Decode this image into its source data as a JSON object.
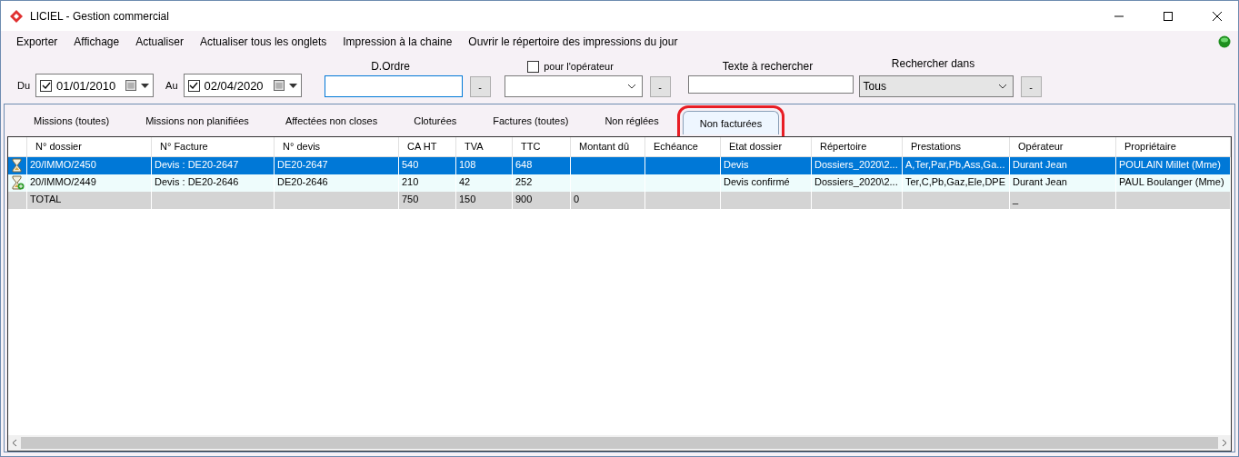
{
  "window": {
    "title": "LICIEL - Gestion commercial"
  },
  "menu": [
    "Exporter",
    "Affichage",
    "Actualiser",
    "Actualiser tous les onglets",
    "Impression à la chaine",
    "Ouvrir le répertoire des impressions du jour"
  ],
  "filters": {
    "from": {
      "label": "Du",
      "checked": true,
      "value": "01/01/2010"
    },
    "to": {
      "label": "Au",
      "checked": true,
      "value": "02/04/2020"
    },
    "order": {
      "label": "D.Ordre",
      "button": "-"
    },
    "operator": {
      "label": "pour l'opérateur",
      "checked": false,
      "button": "-"
    },
    "search": {
      "label": "Texte à rechercher"
    },
    "search_in": {
      "label": "Rechercher dans",
      "value": "Tous",
      "button": "-"
    }
  },
  "tabs": [
    {
      "label": "Missions (toutes)",
      "selected": false,
      "highlighted": false
    },
    {
      "label": "Missions non planifiées",
      "selected": false,
      "highlighted": false
    },
    {
      "label": "Affectées non closes",
      "selected": false,
      "highlighted": false
    },
    {
      "label": "Cloturées",
      "selected": false,
      "highlighted": false
    },
    {
      "label": "Factures (toutes)",
      "selected": false,
      "highlighted": false
    },
    {
      "label": "Non réglées",
      "selected": false,
      "highlighted": false
    },
    {
      "label": "Non facturées",
      "selected": true,
      "highlighted": true
    }
  ],
  "table": {
    "columns": [
      "N° dossier",
      "N° Facture",
      "N° devis",
      "CA HT",
      "TVA",
      "TTC",
      "Montant dû",
      "Echéance",
      "Etat dossier",
      "Répertoire",
      "Prestations",
      "Opérateur",
      "Propriétaire"
    ],
    "rows": [
      {
        "kind": "hourglass",
        "selected": true,
        "cells": [
          "20/IMMO/2450",
          "Devis : DE20-2647",
          "DE20-2647",
          "540",
          "108",
          "648",
          null,
          null,
          "Devis",
          "Dossiers_2020\\2...",
          "A,Ter,Par,Pb,Ass,Ga...",
          "Durant Jean",
          "POULAIN Millet (Mme)"
        ]
      },
      {
        "kind": "hourglass-plus",
        "selected": false,
        "cells": [
          "20/IMMO/2449",
          "Devis : DE20-2646",
          "DE20-2646",
          "210",
          "42",
          "252",
          null,
          null,
          "Devis confirmé",
          "Dossiers_2020\\2...",
          "Ter,C,Pb,Gaz,Ele,DPE",
          "Durant Jean",
          "PAUL Boulanger (Mme)"
        ]
      },
      {
        "kind": "total",
        "selected": false,
        "cells": [
          "TOTAL",
          null,
          null,
          "750",
          "150",
          "900",
          "0",
          null,
          null,
          null,
          null,
          "_",
          null
        ]
      }
    ]
  }
}
